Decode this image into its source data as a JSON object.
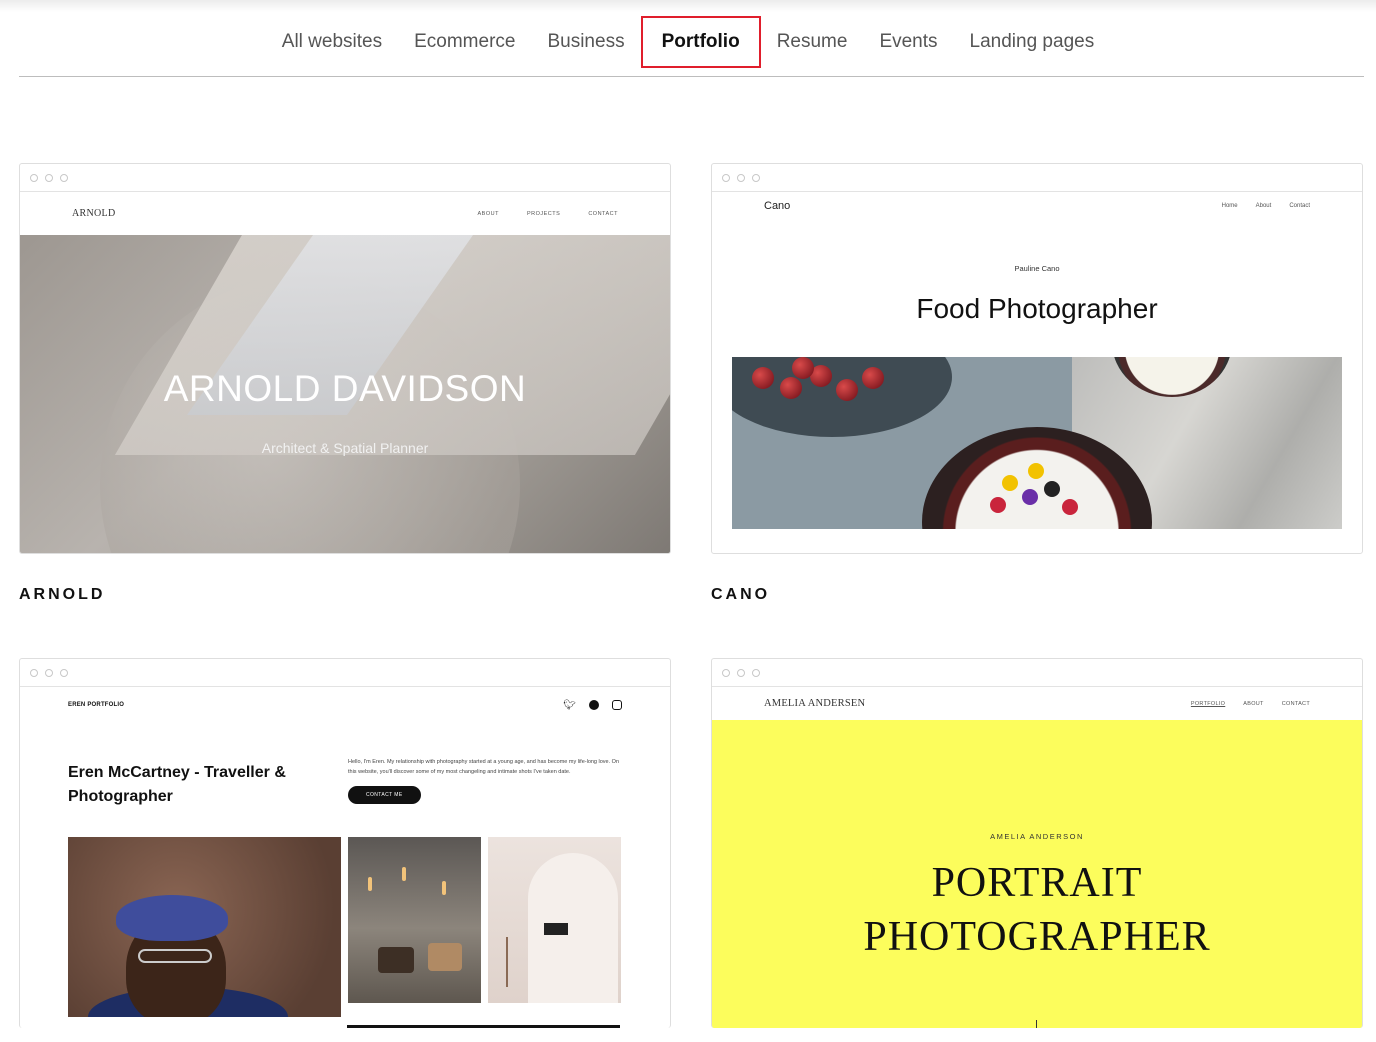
{
  "tabs": [
    {
      "label": "All websites",
      "active": false
    },
    {
      "label": "Ecommerce",
      "active": false
    },
    {
      "label": "Business",
      "active": false
    },
    {
      "label": "Portfolio",
      "active": true
    },
    {
      "label": "Resume",
      "active": false
    },
    {
      "label": "Events",
      "active": false
    },
    {
      "label": "Landing pages",
      "active": false
    }
  ],
  "colors": {
    "highlight": "#e01e2c",
    "amelia_yellow": "#fcfd5c"
  },
  "templates": {
    "arnold": {
      "name": "ARNOLD",
      "logo": "ARNOLD",
      "nav": [
        "ABOUT",
        "PROJECTS",
        "CONTACT"
      ],
      "hero_title": "ARNOLD DAVIDSON",
      "hero_subtitle": "Architect & Spatial Planner"
    },
    "cano": {
      "name": "CANO",
      "logo": "Cano",
      "nav": [
        "Home",
        "About",
        "Contact"
      ],
      "eyebrow": "Pauline Cano",
      "title": "Food Photographer"
    },
    "eren": {
      "logo": "EREN PORTFOLIO",
      "icons": [
        "twitter-icon",
        "facebook-icon",
        "instagram-icon"
      ],
      "title": "Eren McCartney - Traveller & Photographer",
      "text": "Hello, I'm Eren. My relationship with photography started at a young age, and has become my life-long love. On this website, you'll discover some of my most changeling and intimate shots I've taken date.",
      "button": "CONTACT ME"
    },
    "amelia": {
      "logo": "AMELIA ANDERSEN",
      "nav": [
        "PORTFOLIO",
        "ABOUT",
        "CONTACT"
      ],
      "eyebrow": "AMELIA ANDERSON",
      "title_line1": "PORTRAIT",
      "title_line2": "PHOTOGRAPHER"
    }
  }
}
